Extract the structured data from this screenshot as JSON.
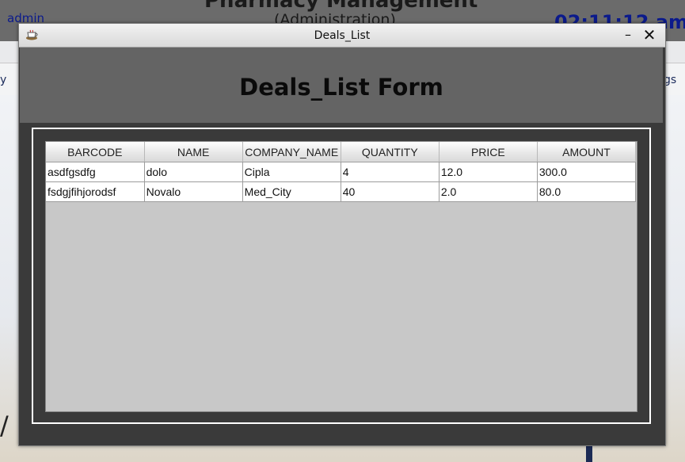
{
  "background": {
    "user": "admin",
    "app_title": "Pharmacy Management",
    "app_subtitle": "(Administration)",
    "clock": "02:11:12 am",
    "menu_left_fragment": "y",
    "menu_right_fragment": "gs",
    "side_fragment": "/"
  },
  "window": {
    "title": "Deals_List",
    "minimize_label": "–",
    "close_label": "✕",
    "app_icon": "java-cup-icon"
  },
  "form": {
    "title": "Deals_List Form"
  },
  "table": {
    "columns": [
      "BARCODE",
      "NAME",
      "COMPANY_NAME",
      "QUANTITY",
      "PRICE",
      "AMOUNT"
    ],
    "rows": [
      [
        "asdfgsdfg",
        "dolo",
        "Cipla",
        "4",
        "12.0",
        "300.0"
      ],
      [
        "fsdgjfihjorodsf",
        "Novalo",
        "Med_City",
        "40",
        "2.0",
        "80.0"
      ]
    ]
  },
  "colors": {
    "header_bar": "#646464",
    "window_body": "#3a3a3a",
    "table_area": "#c8c8c8",
    "clock_blue": "#0b1a8c"
  }
}
